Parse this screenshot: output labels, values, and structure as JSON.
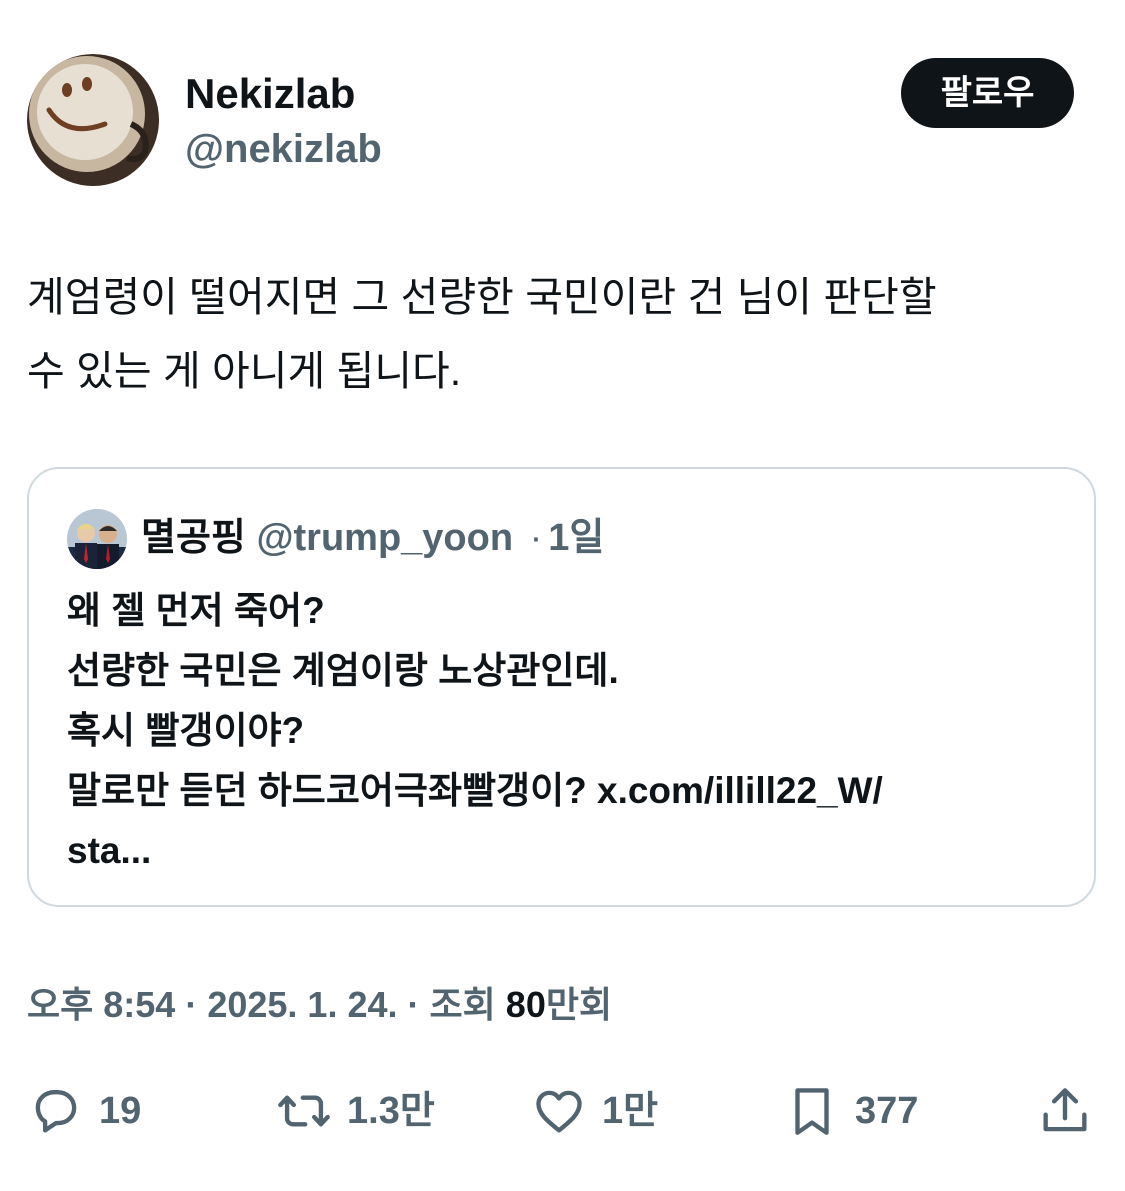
{
  "author": {
    "display_name": "Nekizlab",
    "handle": "@nekizlab",
    "avatar_icon": "smiley-latte-avatar"
  },
  "follow_button": {
    "label": "팔로우"
  },
  "tweet": {
    "lines": [
      "계엄령이 떨어지면 그 선량한 국민이란 건 님이 판단할",
      "수 있는 게 아니게 됩니다."
    ]
  },
  "quote": {
    "display_name": "멸공핑",
    "handle": "@trump_yoon",
    "separator": "·",
    "time": "1일",
    "lines": [
      "왜 젤 먼저 죽어?",
      "선량한 국민은 계엄이랑 노상관인데.",
      "혹시 빨갱이야?",
      "말로만 듣던 하드코어극좌빨갱이? x.com/illill22_W/",
      "sta..."
    ]
  },
  "meta": {
    "time": "오후 8:54",
    "separator": "·",
    "date": "2025. 1. 24.",
    "views_prefix": "조회",
    "views_count": "80",
    "views_suffix": "만회"
  },
  "actions": {
    "reply_count": "19",
    "retweet_count": "1.3만",
    "like_count": "1만",
    "bookmark_count": "377"
  },
  "colors": {
    "text": "#0f1419",
    "secondary": "#536471",
    "border": "#cfd9de",
    "button_bg": "#0f1419"
  }
}
